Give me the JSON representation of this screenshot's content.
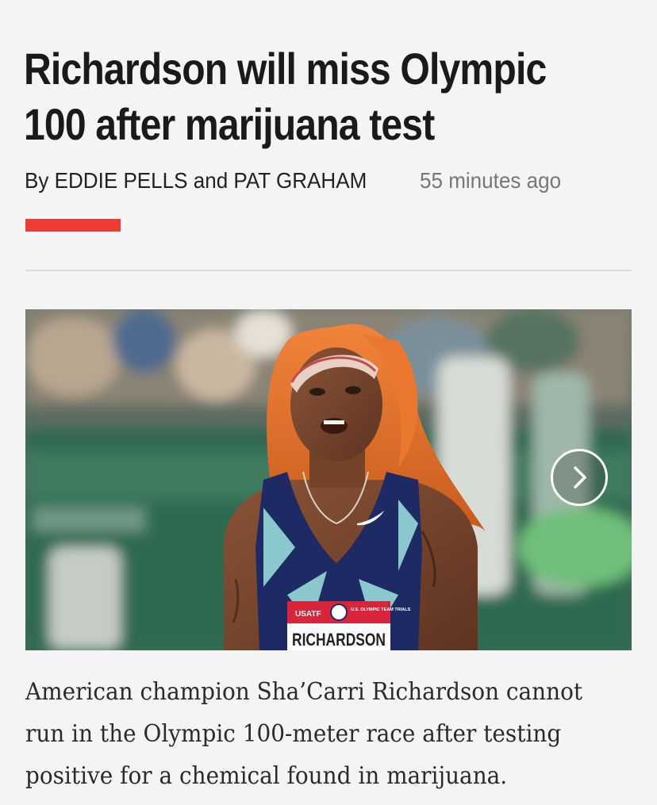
{
  "article": {
    "headline": "Richardson will miss Olympic 100 after marijuana test",
    "byline": "By EDDIE PELLS and PAT GRAHAM",
    "timestamp": "55 minutes ago",
    "caption": "American champion Sha’Carri Richardson cannot run in the Olympic 100-meter race after testing positive for a chemical found in marijuana."
  },
  "photo": {
    "bib_name": "RICHARDSON",
    "bib_brand": "USATF",
    "bib_event": "U.S. OLYMPIC TEAM TRIALS",
    "next_icon": "chevron-right-icon"
  },
  "colors": {
    "accent": "#ef3b36",
    "background": "#f4f4f4",
    "headline": "#1a1a1a",
    "timestamp": "#777777"
  }
}
